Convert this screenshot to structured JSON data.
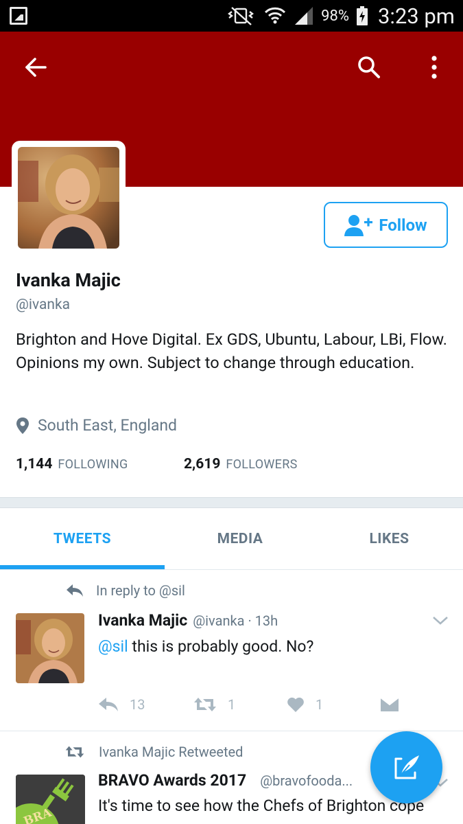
{
  "status_bar": {
    "battery_percent": "98%",
    "time": "3:23 pm"
  },
  "header": {
    "back_icon": "arrow-left-icon",
    "search_icon": "search-icon",
    "menu_icon": "more-vertical-icon",
    "banner_color": "#990000"
  },
  "profile": {
    "follow_label": "Follow",
    "name": "Ivanka Majic",
    "handle": "@ivanka",
    "bio": "Brighton and Hove Digital. Ex GDS, Ubuntu, Labour, LBi, Flow.  Opinions my own. Subject to change through education.",
    "location": "South East, England",
    "following_count": "1,144",
    "following_label": "FOLLOWING",
    "followers_count": "2,619",
    "followers_label": "FOLLOWERS"
  },
  "tabs": [
    {
      "label": "TWEETS",
      "active": true
    },
    {
      "label": "MEDIA",
      "active": false
    },
    {
      "label": "LIKES",
      "active": false
    }
  ],
  "tweets": [
    {
      "context": "In reply to @sil",
      "name": "Ivanka Majic",
      "meta": "@ivanka · 13h",
      "mention": "@sil",
      "text": " this is probably good. No?",
      "replies": "13",
      "retweets": "1",
      "likes": "1"
    },
    {
      "context": "Ivanka Majic Retweeted",
      "name": "BRAVO Awards 2017",
      "meta": "@bravofooda...",
      "text": "It's time to see how the Chefs of Brighton cope",
      "avatar_text": "BRA"
    }
  ],
  "colors": {
    "accent": "#1da1f2",
    "muted": "#657786",
    "icon_muted": "#aab8c2"
  }
}
